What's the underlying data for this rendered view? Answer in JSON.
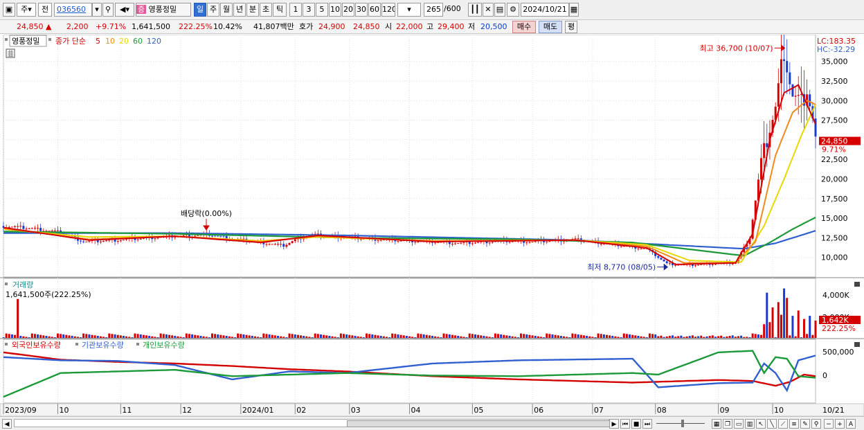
{
  "toolbar": {
    "market": "주",
    "prev": "전",
    "code": "036560",
    "name_badge": "증",
    "name": "영풍정밀",
    "periods": [
      "일",
      "주",
      "월",
      "년",
      "분",
      "초",
      "틱"
    ],
    "active_period": "일",
    "ticks": [
      "1",
      "3",
      "5",
      "10",
      "20",
      "30",
      "60",
      "120"
    ],
    "count": "265",
    "count_total": "/600",
    "date": "2024/10/21"
  },
  "quote": {
    "price": "24,850",
    "change_arrow": "▲",
    "change": "2,200",
    "change_pct": "+9.71%",
    "volume": "1,641,500",
    "volume_ratio": "222.25%",
    "turnover": "10.42%",
    "amount": "41,807백만",
    "ask_label": "호가",
    "ask": "24,900",
    "bid": "24,850",
    "open_label": "시",
    "open": "22,000",
    "high_label": "고",
    "high": "29,400",
    "low_label": "저",
    "low": "20,500",
    "buy_label": "매수",
    "sell_label": "매도",
    "eval_label": "평"
  },
  "chart_data": {
    "type": "line",
    "price_pane": {
      "legend_name": "영풍정밀",
      "legend_ma": "종가 단순",
      "ma_periods": [
        {
          "label": "5",
          "color": "#d40000"
        },
        {
          "label": "10",
          "color": "#f08a1c"
        },
        {
          "label": "20",
          "color": "#e8d800"
        },
        {
          "label": "60",
          "color": "#1c9a3a"
        },
        {
          "label": "120",
          "color": "#3060d0"
        }
      ],
      "lc": "LC:183.35",
      "hc": "HC:-32.29",
      "ylim": [
        7500,
        37000
      ],
      "yticks": [
        10000,
        12500,
        15000,
        17500,
        20000,
        22500,
        25000,
        27500,
        30000,
        32500,
        35000
      ],
      "ytick_labels": [
        "10,000",
        "12,500",
        "15,000",
        "17,500",
        "20,000",
        "22,500",
        "25,000",
        "27,500",
        "30,000",
        "32,500",
        "35,000"
      ],
      "current_price": 24850,
      "current_price_label": "24,850",
      "current_pct_label": "9.71%",
      "high_annotation": "최고 36,700 (10/07)",
      "high_value": 36700,
      "low_annotation": "최저 8,770 (08/05)",
      "low_value": 8770,
      "dividend_annotation": "배당락(0.00%)",
      "close_points": [
        [
          0,
          14000
        ],
        [
          10,
          13700
        ],
        [
          20,
          13200
        ],
        [
          28,
          12000
        ],
        [
          40,
          12200
        ],
        [
          55,
          12600
        ],
        [
          72,
          12900
        ],
        [
          80,
          12400
        ],
        [
          90,
          11900
        ],
        [
          98,
          11500
        ],
        [
          103,
          12400
        ],
        [
          108,
          12900
        ],
        [
          115,
          12700
        ],
        [
          130,
          12300
        ],
        [
          150,
          12000
        ],
        [
          160,
          11800
        ],
        [
          175,
          12100
        ],
        [
          185,
          12000
        ],
        [
          200,
          12300
        ],
        [
          210,
          11800
        ],
        [
          225,
          11100
        ],
        [
          232,
          9200
        ],
        [
          240,
          9000
        ],
        [
          248,
          9200
        ],
        [
          256,
          9300
        ],
        [
          261,
          12500
        ],
        [
          265,
          22000
        ],
        [
          268,
          26500
        ],
        [
          270,
          29000
        ],
        [
          272,
          34000
        ],
        [
          273,
          36700
        ],
        [
          276,
          30500
        ],
        [
          279,
          29500
        ],
        [
          281,
          31500
        ],
        [
          283,
          27500
        ],
        [
          284,
          24850
        ]
      ],
      "ma_points": {
        "5": [
          [
            0,
            13800
          ],
          [
            30,
            12200
          ],
          [
            60,
            12700
          ],
          [
            90,
            11900
          ],
          [
            110,
            12800
          ],
          [
            150,
            12000
          ],
          [
            200,
            12200
          ],
          [
            225,
            11200
          ],
          [
            235,
            9100
          ],
          [
            256,
            9300
          ],
          [
            262,
            13000
          ],
          [
            268,
            25000
          ],
          [
            273,
            31000
          ],
          [
            278,
            32000
          ],
          [
            284,
            27000
          ]
        ],
        "10": [
          [
            0,
            13700
          ],
          [
            30,
            12300
          ],
          [
            60,
            12700
          ],
          [
            90,
            12000
          ],
          [
            110,
            12700
          ],
          [
            150,
            12100
          ],
          [
            200,
            12200
          ],
          [
            225,
            11400
          ],
          [
            238,
            9300
          ],
          [
            256,
            9300
          ],
          [
            263,
            12000
          ],
          [
            270,
            23000
          ],
          [
            276,
            28500
          ],
          [
            281,
            30000
          ],
          [
            284,
            29500
          ]
        ],
        "20": [
          [
            0,
            13600
          ],
          [
            30,
            12600
          ],
          [
            60,
            12700
          ],
          [
            90,
            12100
          ],
          [
            110,
            12600
          ],
          [
            150,
            12100
          ],
          [
            200,
            12200
          ],
          [
            225,
            11600
          ],
          [
            240,
            9600
          ],
          [
            258,
            9400
          ],
          [
            266,
            14000
          ],
          [
            273,
            20000
          ],
          [
            279,
            25500
          ],
          [
            284,
            29500
          ]
        ],
        "60": [
          [
            0,
            13300
          ],
          [
            60,
            13000
          ],
          [
            120,
            12500
          ],
          [
            180,
            12300
          ],
          [
            220,
            11900
          ],
          [
            259,
            10200
          ],
          [
            268,
            11900
          ],
          [
            276,
            13600
          ],
          [
            284,
            15100
          ]
        ],
        "120": [
          [
            0,
            13100
          ],
          [
            60,
            13100
          ],
          [
            120,
            12800
          ],
          [
            200,
            12200
          ],
          [
            259,
            11100
          ],
          [
            270,
            11800
          ],
          [
            284,
            13400
          ]
        ]
      }
    },
    "volume_pane": {
      "title": "거래량",
      "current_label": "1,641,500주(222.25%)",
      "yticks_labels": [
        "4,000K",
        "2,000K"
      ],
      "ylim": [
        0,
        5000000
      ],
      "current_value": 1641500,
      "current_tag": "1,642K",
      "current_pct": "222.25%",
      "spikes": [
        [
          5,
          3700000
        ],
        [
          266,
          1300000
        ],
        [
          267,
          4300000
        ],
        [
          268,
          1500000
        ],
        [
          269,
          2900000
        ],
        [
          271,
          3400000
        ],
        [
          272,
          2200000
        ],
        [
          273,
          4700000
        ],
        [
          274,
          3800000
        ],
        [
          276,
          2100000
        ],
        [
          278,
          2600000
        ],
        [
          280,
          1800000
        ],
        [
          282,
          2100000
        ],
        [
          284,
          1642000
        ]
      ]
    },
    "holdings_pane": {
      "legend": [
        {
          "name": "외국인보유수량",
          "color": "#d40000"
        },
        {
          "name": "기관보유수량",
          "color": "#3060d0"
        },
        {
          "name": "개인보유수량",
          "color": "#1c9a3a"
        }
      ],
      "ylim": [
        -1000000,
        700000
      ],
      "yticks": [
        500000,
        0
      ],
      "ytick_labels": [
        "500,000",
        "0"
      ],
      "foreign": [
        [
          0,
          550000
        ],
        [
          20,
          320000
        ],
        [
          40,
          250000
        ],
        [
          60,
          200000
        ],
        [
          80,
          120000
        ],
        [
          100,
          20000
        ],
        [
          120,
          -50000
        ],
        [
          150,
          -200000
        ],
        [
          180,
          -300000
        ],
        [
          220,
          -400000
        ],
        [
          250,
          -320000
        ],
        [
          262,
          -350000
        ],
        [
          270,
          -500000
        ],
        [
          275,
          -380000
        ],
        [
          280,
          -150000
        ],
        [
          284,
          -200000
        ]
      ],
      "institution": [
        [
          0,
          400000
        ],
        [
          20,
          300000
        ],
        [
          40,
          280000
        ],
        [
          60,
          150000
        ],
        [
          80,
          -300000
        ],
        [
          100,
          -50000
        ],
        [
          120,
          -100000
        ],
        [
          150,
          200000
        ],
        [
          180,
          300000
        ],
        [
          220,
          350000
        ],
        [
          229,
          -550000
        ],
        [
          250,
          -420000
        ],
        [
          262,
          -400000
        ],
        [
          266,
          200000
        ],
        [
          270,
          -100000
        ],
        [
          274,
          -650000
        ],
        [
          278,
          300000
        ],
        [
          284,
          450000
        ]
      ],
      "individual": [
        [
          0,
          -850000
        ],
        [
          20,
          -100000
        ],
        [
          40,
          -50000
        ],
        [
          60,
          0
        ],
        [
          80,
          -200000
        ],
        [
          100,
          -150000
        ],
        [
          120,
          -100000
        ],
        [
          150,
          -180000
        ],
        [
          180,
          -200000
        ],
        [
          220,
          -100000
        ],
        [
          229,
          -150000
        ],
        [
          250,
          550000
        ],
        [
          262,
          600000
        ],
        [
          266,
          -100000
        ],
        [
          270,
          400000
        ],
        [
          274,
          350000
        ],
        [
          278,
          -200000
        ],
        [
          284,
          -250000
        ]
      ]
    },
    "x_labels": [
      "2023/09",
      "10",
      "11",
      "12",
      "2024/01",
      "02",
      "03",
      "04",
      "05",
      "06",
      "07",
      "08",
      "09",
      "10",
      "10/21"
    ]
  },
  "statusbar": {
    "nav_prev": "◀",
    "nav_next": "▶"
  }
}
